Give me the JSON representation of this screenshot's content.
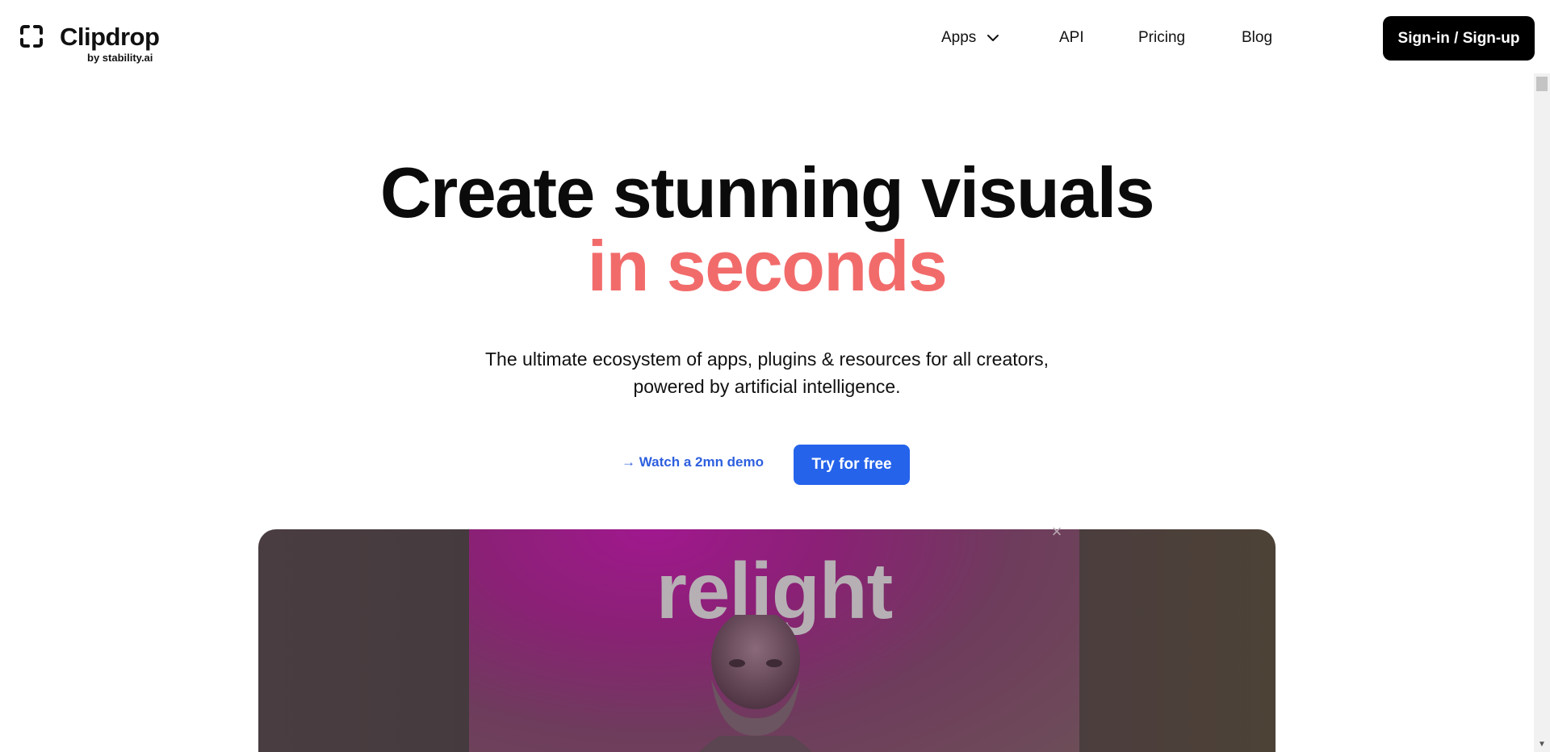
{
  "header": {
    "logo_name": "Clipdrop",
    "logo_sub": "by stability.ai",
    "nav": {
      "apps": "Apps",
      "api": "API",
      "pricing": "Pricing",
      "blog": "Blog"
    },
    "signin_label": "Sign-in / Sign-up"
  },
  "hero": {
    "title_line1": "Create stunning visuals",
    "title_line2": "in seconds",
    "subtitle_line1": "The ultimate ecosystem of apps, plugins & resources for all creators,",
    "subtitle_line2": "powered by artificial intelligence.",
    "demo_link": "→ Watch a 2mn demo",
    "cta_label": "Try for free"
  },
  "video": {
    "word": "relight",
    "close_symbol": "×"
  },
  "colors": {
    "accent_coral": "#f26b6b",
    "primary_blue": "#2563eb",
    "link_blue": "#2d5fdf",
    "black": "#000000"
  },
  "icons": {
    "logo": "clipdrop-corners-icon",
    "apps_dropdown": "chevron-down-icon",
    "video_close": "close-icon",
    "scroll_down": "scroll-down-arrow-icon"
  }
}
